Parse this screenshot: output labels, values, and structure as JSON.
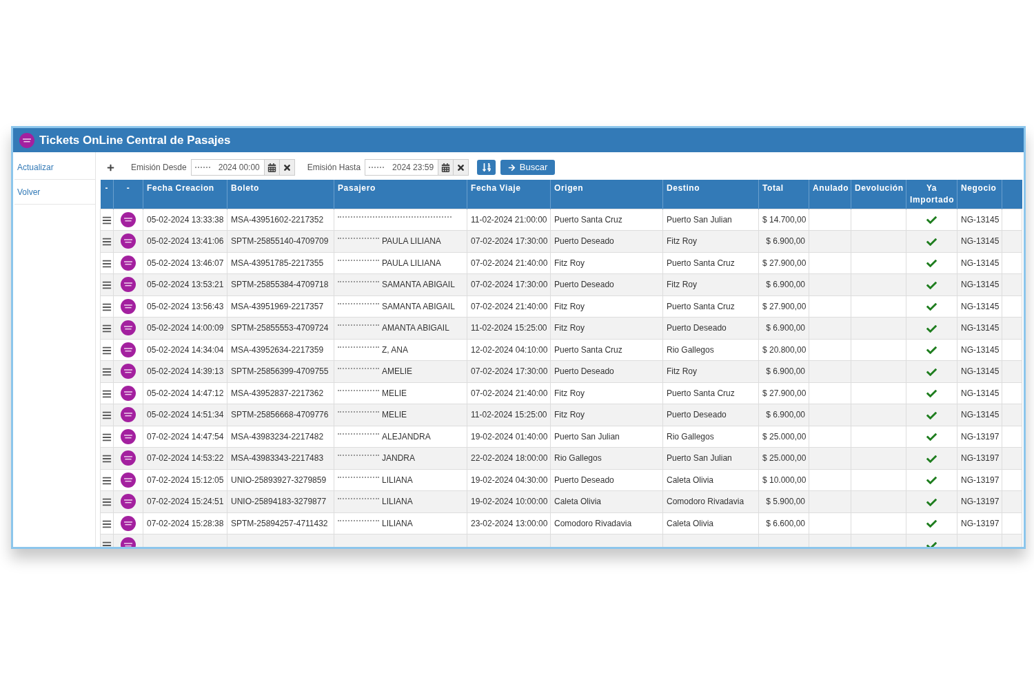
{
  "window": {
    "title": "Tickets OnLine Central de Pasajes"
  },
  "sidebar": {
    "items": [
      "Actualizar",
      "Volver"
    ]
  },
  "filters": [
    {
      "label": "Emisión Desde",
      "value": "2024 00:00",
      "redacted": true
    },
    {
      "label": "Emisión Hasta",
      "value": "2024 23:59",
      "redacted": true
    }
  ],
  "search_button": {
    "label": "Buscar"
  },
  "table": {
    "columns": [
      "-",
      "-",
      "Fecha Creacion",
      "Boleto",
      "Pasajero",
      "Fecha Viaje",
      "Origen",
      "Destino",
      "Total",
      "Anulado",
      "Devolución",
      "Ya Importado",
      "Negocio"
    ],
    "rows": [
      {
        "created": "05-02-2024 13:33:38",
        "ticket": "MSA-43951602-2217352",
        "passenger": {
          "redacted": true
        },
        "travel_date": "11-02-2024 21:00:00",
        "origin": "Puerto Santa Cruz",
        "destination": "Puerto San Julian",
        "total": "$ 14.700,00",
        "imported": true,
        "business": "NG-13145"
      },
      {
        "created": "05-02-2024 13:41:06",
        "ticket": "SPTM-25855140-4709709",
        "passenger": {
          "text": "PAULA LILIANA",
          "redacted": true
        },
        "travel_date": "07-02-2024 17:30:00",
        "origin": "Puerto Deseado",
        "destination": "Fitz Roy",
        "total": "$ 6.900,00",
        "imported": true,
        "business": "NG-13145"
      },
      {
        "created": "05-02-2024 13:46:07",
        "ticket": "MSA-43951785-2217355",
        "passenger": {
          "text": "PAULA LILIANA",
          "redacted": true
        },
        "travel_date": "07-02-2024 21:40:00",
        "origin": "Fitz Roy",
        "destination": "Puerto Santa Cruz",
        "total": "$ 27.900,00",
        "imported": true,
        "business": "NG-13145"
      },
      {
        "created": "05-02-2024 13:53:21",
        "ticket": "SPTM-25855384-4709718",
        "passenger": {
          "text": "SAMANTA ABIGAIL",
          "redacted": true
        },
        "travel_date": "07-02-2024 17:30:00",
        "origin": "Puerto Deseado",
        "destination": "Fitz Roy",
        "total": "$ 6.900,00",
        "imported": true,
        "business": "NG-13145"
      },
      {
        "created": "05-02-2024 13:56:43",
        "ticket": "MSA-43951969-2217357",
        "passenger": {
          "text": "SAMANTA ABIGAIL",
          "redacted": true
        },
        "travel_date": "07-02-2024 21:40:00",
        "origin": "Fitz Roy",
        "destination": "Puerto Santa Cruz",
        "total": "$ 27.900,00",
        "imported": true,
        "business": "NG-13145"
      },
      {
        "created": "05-02-2024 14:00:09",
        "ticket": "SPTM-25855553-4709724",
        "passenger": {
          "text": "AMANTA ABIGAIL",
          "redacted": true
        },
        "travel_date": "11-02-2024 15:25:00",
        "origin": "Fitz Roy",
        "destination": "Puerto Deseado",
        "total": "$ 6.900,00",
        "imported": true,
        "business": "NG-13145"
      },
      {
        "created": "05-02-2024 14:34:04",
        "ticket": "MSA-43952634-2217359",
        "passenger": {
          "text": "Z, ANA",
          "redacted": true
        },
        "travel_date": "12-02-2024 04:10:00",
        "origin": "Puerto Santa Cruz",
        "destination": "Rio Gallegos",
        "total": "$ 20.800,00",
        "imported": true,
        "business": "NG-13145"
      },
      {
        "created": "05-02-2024 14:39:13",
        "ticket": "SPTM-25856399-4709755",
        "passenger": {
          "text": "AMELIE",
          "redacted": true
        },
        "travel_date": "07-02-2024 17:30:00",
        "origin": "Puerto Deseado",
        "destination": "Fitz Roy",
        "total": "$ 6.900,00",
        "imported": true,
        "business": "NG-13145"
      },
      {
        "created": "05-02-2024 14:47:12",
        "ticket": "MSA-43952837-2217362",
        "passenger": {
          "text": "MELIE",
          "redacted": true
        },
        "travel_date": "07-02-2024 21:40:00",
        "origin": "Fitz Roy",
        "destination": "Puerto Santa Cruz",
        "total": "$ 27.900,00",
        "imported": true,
        "business": "NG-13145"
      },
      {
        "created": "05-02-2024 14:51:34",
        "ticket": "SPTM-25856668-4709776",
        "passenger": {
          "text": "MELIE",
          "redacted": true
        },
        "travel_date": "11-02-2024 15:25:00",
        "origin": "Fitz Roy",
        "destination": "Puerto Deseado",
        "total": "$ 6.900,00",
        "imported": true,
        "business": "NG-13145"
      },
      {
        "created": "07-02-2024 14:47:54",
        "ticket": "MSA-43983234-2217482",
        "passenger": {
          "text": "ALEJANDRA",
          "redacted": true
        },
        "travel_date": "19-02-2024 01:40:00",
        "origin": "Puerto San Julian",
        "destination": "Rio Gallegos",
        "total": "$ 25.000,00",
        "imported": true,
        "business": "NG-13197"
      },
      {
        "created": "07-02-2024 14:53:22",
        "ticket": "MSA-43983343-2217483",
        "passenger": {
          "text": "JANDRA",
          "redacted": true
        },
        "travel_date": "22-02-2024 18:00:00",
        "origin": "Rio Gallegos",
        "destination": "Puerto San Julian",
        "total": "$ 25.000,00",
        "imported": true,
        "business": "NG-13197"
      },
      {
        "created": "07-02-2024 15:12:05",
        "ticket": "UNIO-25893927-3279859",
        "passenger": {
          "text": "LILIANA",
          "redacted": true
        },
        "travel_date": "19-02-2024 04:30:00",
        "origin": "Puerto Deseado",
        "destination": "Caleta Olivia",
        "total": "$ 10.000,00",
        "imported": true,
        "business": "NG-13197"
      },
      {
        "created": "07-02-2024 15:24:51",
        "ticket": "UNIO-25894183-3279877",
        "passenger": {
          "text": "LILIANA",
          "redacted": true
        },
        "travel_date": "19-02-2024 10:00:00",
        "origin": "Caleta Olivia",
        "destination": "Comodoro Rivadavia",
        "total": "$ 5.900,00",
        "imported": true,
        "business": "NG-13197"
      },
      {
        "created": "07-02-2024 15:28:38",
        "ticket": "SPTM-25894257-4711432",
        "passenger": {
          "text": "LILIANA",
          "redacted": true
        },
        "travel_date": "23-02-2024 13:00:00",
        "origin": "Comodoro Rivadavia",
        "destination": "Caleta Olivia",
        "total": "$ 6.600,00",
        "imported": true,
        "business": "NG-13197"
      }
    ],
    "partial_row": {
      "imported": true
    }
  }
}
